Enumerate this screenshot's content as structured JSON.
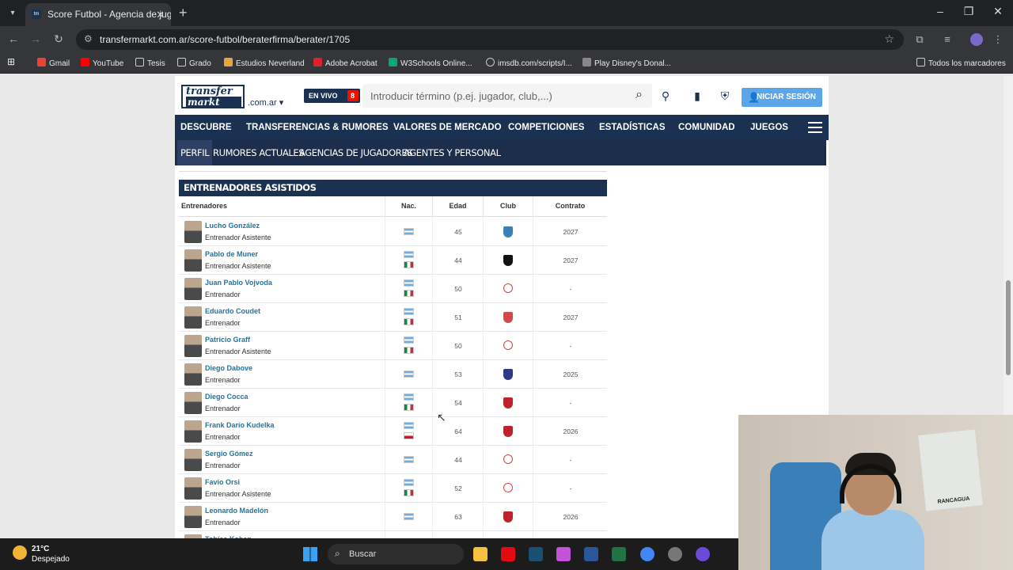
{
  "browser": {
    "tab_title": "Score Futbol - Agencia de jugadores",
    "url": "transfermarkt.com.ar/score-futbol/beraterfirma/berater/1705",
    "bookmarks": [
      "Gmail",
      "YouTube",
      "Tesis",
      "Grado",
      "Estudios Neverland",
      "Adobe Acrobat",
      "W3Schools Online...",
      "imsdb.com/scripts/I...",
      "Play Disney's Donal...",
      "Todos los marcadores"
    ]
  },
  "site": {
    "logo_top": "transfer",
    "logo_bottom": "markt",
    "domain": ".com.ar",
    "live_label": "EN VIVO",
    "live_count": "8",
    "search_placeholder": "Introducir término (p.ej. jugador, club,...)",
    "login_label": "INICIAR SESIÓN",
    "nav": [
      "DESCUBRE",
      "TRANSFERENCIAS & RUMORES",
      "VALORES DE MERCADO",
      "COMPETICIONES",
      "ESTADÍSTICAS",
      "COMUNIDAD",
      "JUEGOS"
    ],
    "subnav": [
      "PERFIL",
      "RUMORES ACTUALES",
      "AGENCIAS DE JUGADORES",
      "AGENTES Y PERSONAL"
    ]
  },
  "table": {
    "title": "ENTRENADORES ASISTIDOS",
    "headers": [
      "Entrenadores",
      "Nac.",
      "Edad",
      "Club",
      "Contrato"
    ],
    "rows": [
      {
        "name": "Lucho González",
        "role": "Entrenador Asistente",
        "age": "45",
        "contract": "2027"
      },
      {
        "name": "Pablo de Muner",
        "role": "Entrenador Asistente",
        "age": "44",
        "contract": "2027"
      },
      {
        "name": "Juan Pablo Vojvoda",
        "role": "Entrenador",
        "age": "50",
        "contract": "-"
      },
      {
        "name": "Eduardo Coudet",
        "role": "Entrenador",
        "age": "51",
        "contract": "2027"
      },
      {
        "name": "Patricio Graff",
        "role": "Entrenador Asistente",
        "age": "50",
        "contract": "-"
      },
      {
        "name": "Diego Dabove",
        "role": "Entrenador",
        "age": "53",
        "contract": "2025"
      },
      {
        "name": "Diego Cocca",
        "role": "Entrenador",
        "age": "54",
        "contract": "-"
      },
      {
        "name": "Frank Darío Kudelka",
        "role": "Entrenador",
        "age": "64",
        "contract": "2026"
      },
      {
        "name": "Sergio Gómez",
        "role": "Entrenador",
        "age": "44",
        "contract": "-"
      },
      {
        "name": "Favio Orsi",
        "role": "Entrenador Asistente",
        "age": "52",
        "contract": "-"
      },
      {
        "name": "Leonardo Madelón",
        "role": "Entrenador",
        "age": "63",
        "contract": "2026"
      },
      {
        "name": "Tobías Kohan",
        "role": "",
        "age": "",
        "contract": ""
      }
    ]
  },
  "webcam": {
    "flag_text": "RANCAGUA"
  },
  "taskbar": {
    "temp": "21°C",
    "weather": "Despejado",
    "search": "Buscar"
  },
  "colors": {
    "brand": "#1a3151",
    "link": "#1d75a3",
    "login": "#5ba6e8"
  }
}
